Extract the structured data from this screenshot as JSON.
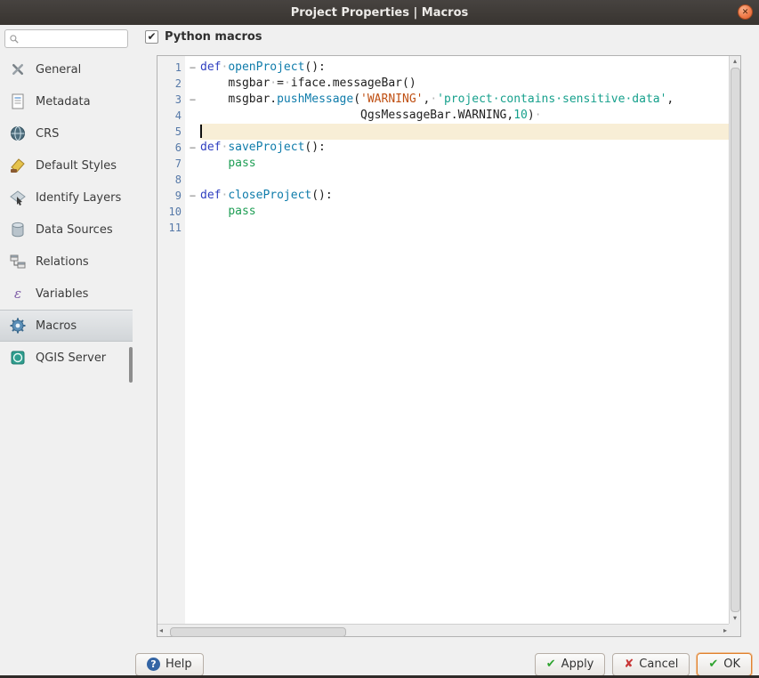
{
  "window": {
    "title": "Project Properties | Macros"
  },
  "icons": {
    "close_glyph": "✕",
    "check_glyph": "✔",
    "cross_glyph": "✘",
    "help_glyph": "?",
    "up_glyph": "▴",
    "down_glyph": "▾",
    "left_glyph": "◂",
    "right_glyph": "▸",
    "fold_collapse_glyph": "−"
  },
  "sidebar": {
    "search": {
      "value": "",
      "placeholder": ""
    },
    "items": [
      {
        "label": "General",
        "icon": "general-icon",
        "selected": false
      },
      {
        "label": "Metadata",
        "icon": "metadata-icon",
        "selected": false
      },
      {
        "label": "CRS",
        "icon": "crs-icon",
        "selected": false
      },
      {
        "label": "Default Styles",
        "icon": "default-styles-icon",
        "selected": false
      },
      {
        "label": "Identify Layers",
        "icon": "identify-layers-icon",
        "selected": false
      },
      {
        "label": "Data Sources",
        "icon": "data-sources-icon",
        "selected": false
      },
      {
        "label": "Relations",
        "icon": "relations-icon",
        "selected": false
      },
      {
        "label": "Variables",
        "icon": "variables-icon",
        "selected": false
      },
      {
        "label": "Macros",
        "icon": "macros-icon",
        "selected": true
      },
      {
        "label": "QGIS Server",
        "icon": "qgis-server-icon",
        "selected": false
      }
    ]
  },
  "content": {
    "python_macros_label": "Python macros",
    "python_macros_checked": true
  },
  "syntax_colors": {
    "keyword": "#2f3fc0",
    "function": "#0f7cab",
    "string_orange": "#bf4f12",
    "string_teal": "#16a08c",
    "number": "#16a08c",
    "minor_keyword": "#1f9e55"
  },
  "editor": {
    "lines": [
      {
        "num": "1",
        "fold": true,
        "tokens": [
          [
            "kw",
            "def"
          ],
          [
            "ws",
            "·"
          ],
          [
            "fn",
            "openProject"
          ],
          [
            "pln",
            "():"
          ]
        ]
      },
      {
        "num": "2",
        "fold": false,
        "tokens": [
          [
            "pln",
            "    "
          ],
          [
            "pln",
            "msgbar"
          ],
          [
            "ws",
            "·"
          ],
          [
            "pln",
            "="
          ],
          [
            "ws",
            "·"
          ],
          [
            "pln",
            "iface.messageBar()"
          ]
        ]
      },
      {
        "num": "3",
        "fold": true,
        "tokens": [
          [
            "pln",
            "    "
          ],
          [
            "pln",
            "msgbar."
          ],
          [
            "fn",
            "pushMessage"
          ],
          [
            "pln",
            "("
          ],
          [
            "str1",
            "'WARNING'"
          ],
          [
            "pln",
            ","
          ],
          [
            "ws",
            "·"
          ],
          [
            "str2",
            "'project·contains·sensitive·data'"
          ],
          [
            "pln",
            ","
          ]
        ]
      },
      {
        "num": "4",
        "fold": false,
        "tokens": [
          [
            "pln",
            "                       "
          ],
          [
            "pln",
            "QgsMessageBar.WARNING,"
          ],
          [
            "num",
            "10"
          ],
          [
            "pln",
            ")"
          ],
          [
            "ws",
            "·"
          ]
        ]
      },
      {
        "num": "5",
        "fold": false,
        "current": true,
        "cursor": true,
        "tokens": []
      },
      {
        "num": "6",
        "fold": true,
        "tokens": [
          [
            "kw",
            "def"
          ],
          [
            "ws",
            "·"
          ],
          [
            "fn",
            "saveProject"
          ],
          [
            "pln",
            "():"
          ]
        ]
      },
      {
        "num": "7",
        "fold": false,
        "tokens": [
          [
            "pln",
            "    "
          ],
          [
            "kw2",
            "pass"
          ]
        ]
      },
      {
        "num": "8",
        "fold": false,
        "tokens": []
      },
      {
        "num": "9",
        "fold": true,
        "tokens": [
          [
            "kw",
            "def"
          ],
          [
            "ws",
            "·"
          ],
          [
            "fn",
            "closeProject"
          ],
          [
            "pln",
            "():"
          ]
        ]
      },
      {
        "num": "10",
        "fold": false,
        "tokens": [
          [
            "pln",
            "    "
          ],
          [
            "kw2",
            "pass"
          ]
        ]
      },
      {
        "num": "11",
        "fold": false,
        "tokens": []
      }
    ]
  },
  "footer": {
    "help": "Help",
    "apply": "Apply",
    "cancel": "Cancel",
    "ok": "OK"
  }
}
